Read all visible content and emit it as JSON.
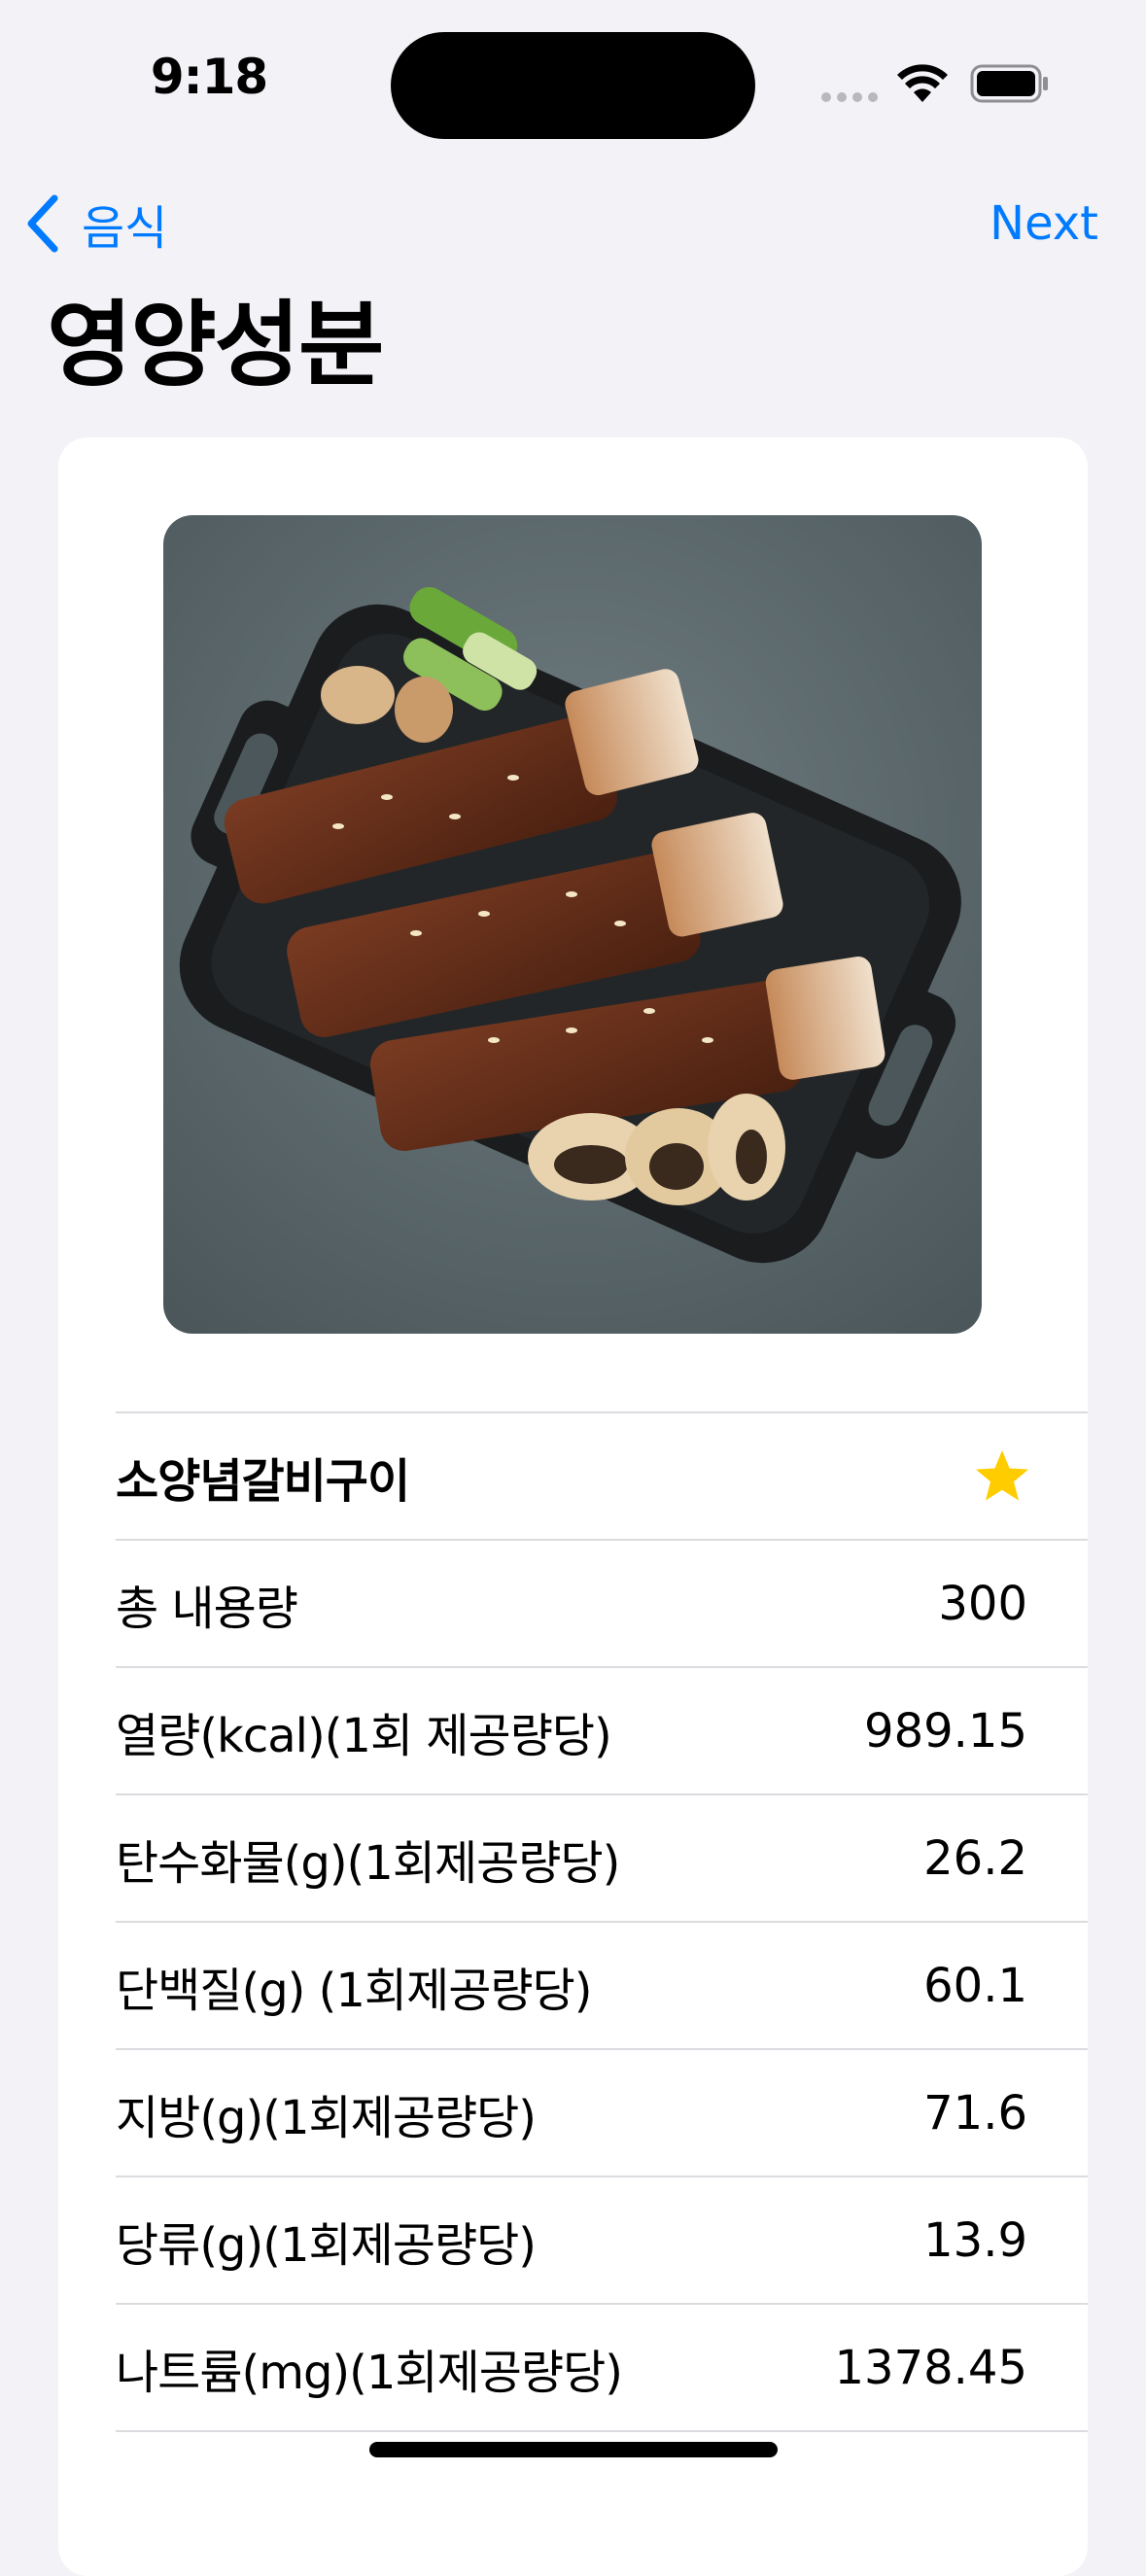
{
  "status_bar": {
    "time": "9:18"
  },
  "nav": {
    "back_label": "음식",
    "next_label": "Next"
  },
  "page": {
    "title": "영양성분"
  },
  "food": {
    "name": "소양념갈비구이",
    "image_alt": "소양념갈비구이",
    "favorite_icon": "star-icon",
    "favorite_color": "#ffcc00"
  },
  "nutrition": [
    {
      "label": "총 내용량",
      "value": "300"
    },
    {
      "label": "열량(kcal)(1회 제공량당)",
      "value": "989.15"
    },
    {
      "label": "탄수화물(g)(1회제공량당)",
      "value": "26.2"
    },
    {
      "label": "단백질(g) (1회제공량당)",
      "value": "60.1"
    },
    {
      "label": "지방(g)(1회제공량당)",
      "value": "71.6"
    },
    {
      "label": "당류(g)(1회제공량당)",
      "value": "13.9"
    },
    {
      "label": "나트륨(mg)(1회제공량당)",
      "value": "1378.45"
    }
  ],
  "colors": {
    "accent": "#007aff",
    "background": "#f2f2f7",
    "card": "#ffffff"
  }
}
